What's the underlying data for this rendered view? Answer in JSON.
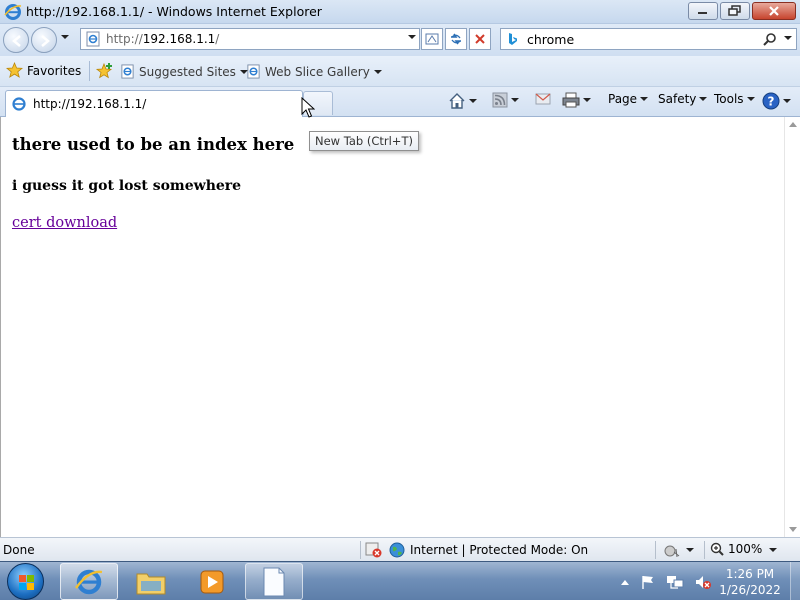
{
  "window": {
    "title": "http://192.168.1.1/ - Windows Internet Explorer"
  },
  "address_bar": {
    "url_protocol": "http://",
    "url_host": "192.168.1.1",
    "url_rest": "/"
  },
  "search": {
    "query": "chrome"
  },
  "favorites_bar": {
    "favorites_label": "Favorites",
    "links": [
      {
        "label": "Suggested Sites"
      },
      {
        "label": "Web Slice Gallery"
      }
    ]
  },
  "tabs": [
    {
      "title": "http://192.168.1.1/"
    }
  ],
  "command_bar": {
    "page_label": "Page",
    "safety_label": "Safety",
    "tools_label": "Tools"
  },
  "tooltip": {
    "text": "New Tab (Ctrl+T)"
  },
  "page": {
    "heading": "there used to be an index here",
    "subheading": "i guess it got lost somewhere",
    "link_text": "cert download",
    "link_color": "#660099"
  },
  "status_bar": {
    "status": "Done",
    "zone": "Internet | Protected Mode: On",
    "zoom": "100%"
  },
  "taskbar": {
    "clock_time": "1:26 PM",
    "clock_date": "1/26/2022",
    "pinned": [
      "internet-explorer",
      "windows-explorer",
      "media-player",
      "notepad"
    ]
  },
  "colors": {
    "accent": "#1d6fc2",
    "close_button": "#c7442e"
  }
}
